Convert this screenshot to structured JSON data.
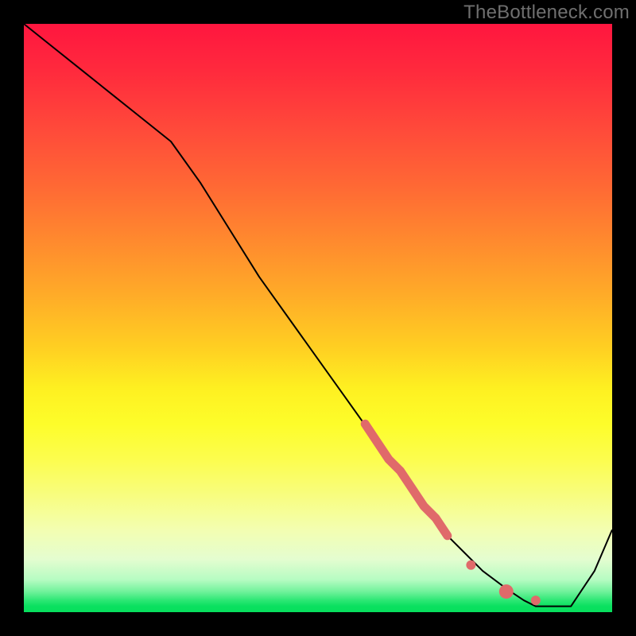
{
  "watermark": "TheBottleneck.com",
  "chart_data": {
    "type": "line",
    "title": "",
    "xlabel": "",
    "ylabel": "",
    "xlim": [
      0,
      100
    ],
    "ylim": [
      0,
      100
    ],
    "grid": false,
    "series": [
      {
        "name": "curve",
        "color": "#000000",
        "stroke_width": 2,
        "x": [
          0,
          5,
          10,
          15,
          20,
          25,
          30,
          35,
          40,
          45,
          50,
          55,
          60,
          62,
          65,
          68,
          72,
          75,
          78,
          82,
          85,
          87,
          90,
          93,
          97,
          100
        ],
        "y": [
          100,
          96,
          92,
          88,
          84,
          80,
          73,
          65,
          57,
          50,
          43,
          36,
          29,
          26,
          22,
          18,
          13,
          10,
          7,
          4,
          2,
          1,
          1,
          1,
          7,
          14
        ]
      }
    ],
    "markers": [
      {
        "name": "highlight-segment",
        "color": "#e06a6a",
        "stroke_width": 11,
        "x": [
          58,
          60,
          62,
          64,
          66,
          68,
          70,
          72
        ],
        "y": [
          32,
          29,
          26,
          24,
          21,
          18,
          16,
          13
        ]
      },
      {
        "name": "dot-1",
        "color": "#e06a6a",
        "radius": 6,
        "cx": 76,
        "cy": 8
      },
      {
        "name": "dot-2",
        "color": "#e06a6a",
        "radius": 9,
        "cx": 82,
        "cy": 3.5
      },
      {
        "name": "dot-3",
        "color": "#e06a6a",
        "radius": 6,
        "cx": 87,
        "cy": 2
      }
    ]
  }
}
